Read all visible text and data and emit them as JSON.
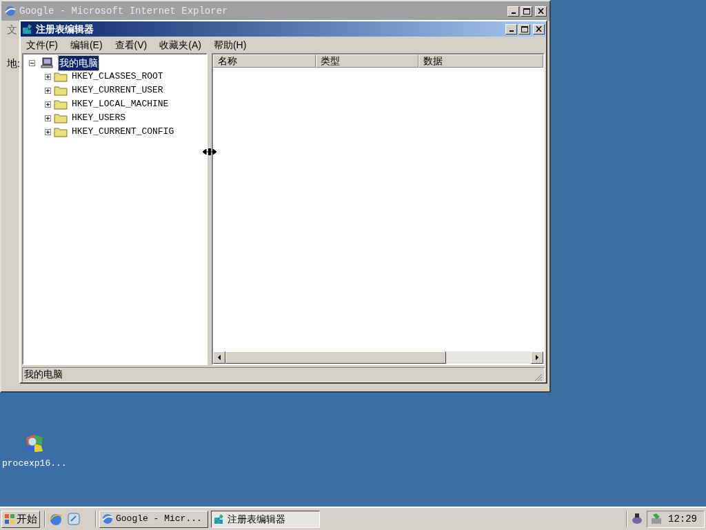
{
  "ie_window": {
    "title": "Google - Microsoft Internet Explorer",
    "menu_fragment": "文",
    "address_label": "地:"
  },
  "regedit": {
    "title": "注册表编辑器",
    "menu": [
      "文件(F)",
      "编辑(E)",
      "查看(V)",
      "收藏夹(A)",
      "帮助(H)"
    ],
    "tree": {
      "label": "我的电脑",
      "selected": true,
      "expanded": true,
      "children": [
        {
          "label": "HKEY_CLASSES_ROOT",
          "expanded": false
        },
        {
          "label": "HKEY_CURRENT_USER",
          "expanded": false
        },
        {
          "label": "HKEY_LOCAL_MACHINE",
          "expanded": false
        },
        {
          "label": "HKEY_USERS",
          "expanded": false
        },
        {
          "label": "HKEY_CURRENT_CONFIG",
          "expanded": false
        }
      ]
    },
    "columns": [
      "名称",
      "类型",
      "数据"
    ],
    "status": "我的电脑"
  },
  "desktop_icons": [
    {
      "label": "procexp16..."
    }
  ],
  "taskbar": {
    "start": "开始",
    "tasks": [
      {
        "label": "Google - Micr...",
        "kind": "ie",
        "selected": false
      },
      {
        "label": "注册表编辑器",
        "kind": "regedit",
        "selected": true
      }
    ],
    "clock": "12:29"
  }
}
